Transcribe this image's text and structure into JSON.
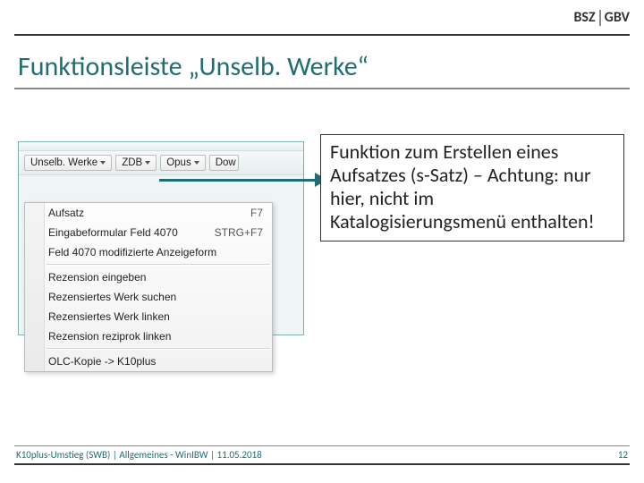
{
  "header": {
    "logo1": "BSZ",
    "logo2": "GBV"
  },
  "title": "Funktionsleiste „Unselb. Werke“",
  "toolbar": {
    "btn1": "Unselb. Werke",
    "btn2": "ZDB",
    "btn3": "Opus",
    "btn4_partial": "Dow"
  },
  "menu": {
    "item1": {
      "label": "Aufsatz",
      "shortcut": "F7"
    },
    "item2": {
      "label": "Eingabeformular Feld 4070",
      "shortcut": "STRG+F7"
    },
    "item3": {
      "label": "Feld 4070 modifizierte Anzeigeform",
      "shortcut": ""
    },
    "item4": {
      "label": "Rezension eingeben",
      "shortcut": ""
    },
    "item5": {
      "label": "Rezensiertes Werk suchen",
      "shortcut": ""
    },
    "item6": {
      "label": "Rezensiertes Werk linken",
      "shortcut": ""
    },
    "item7": {
      "label": "Rezension reziprok linken",
      "shortcut": ""
    },
    "item8": {
      "label": "OLC-Kopie -> K10plus",
      "shortcut": ""
    }
  },
  "callout": "Funktion zum Erstellen eines Aufsatzes (s-Satz) – Achtung: nur hier, nicht im Katalogisierungsmenü enthalten!",
  "footer": {
    "text": "K10plus-Umstieg (SWB) | Allgemeines - WinIBW | 11.05.2018",
    "page": "12"
  }
}
